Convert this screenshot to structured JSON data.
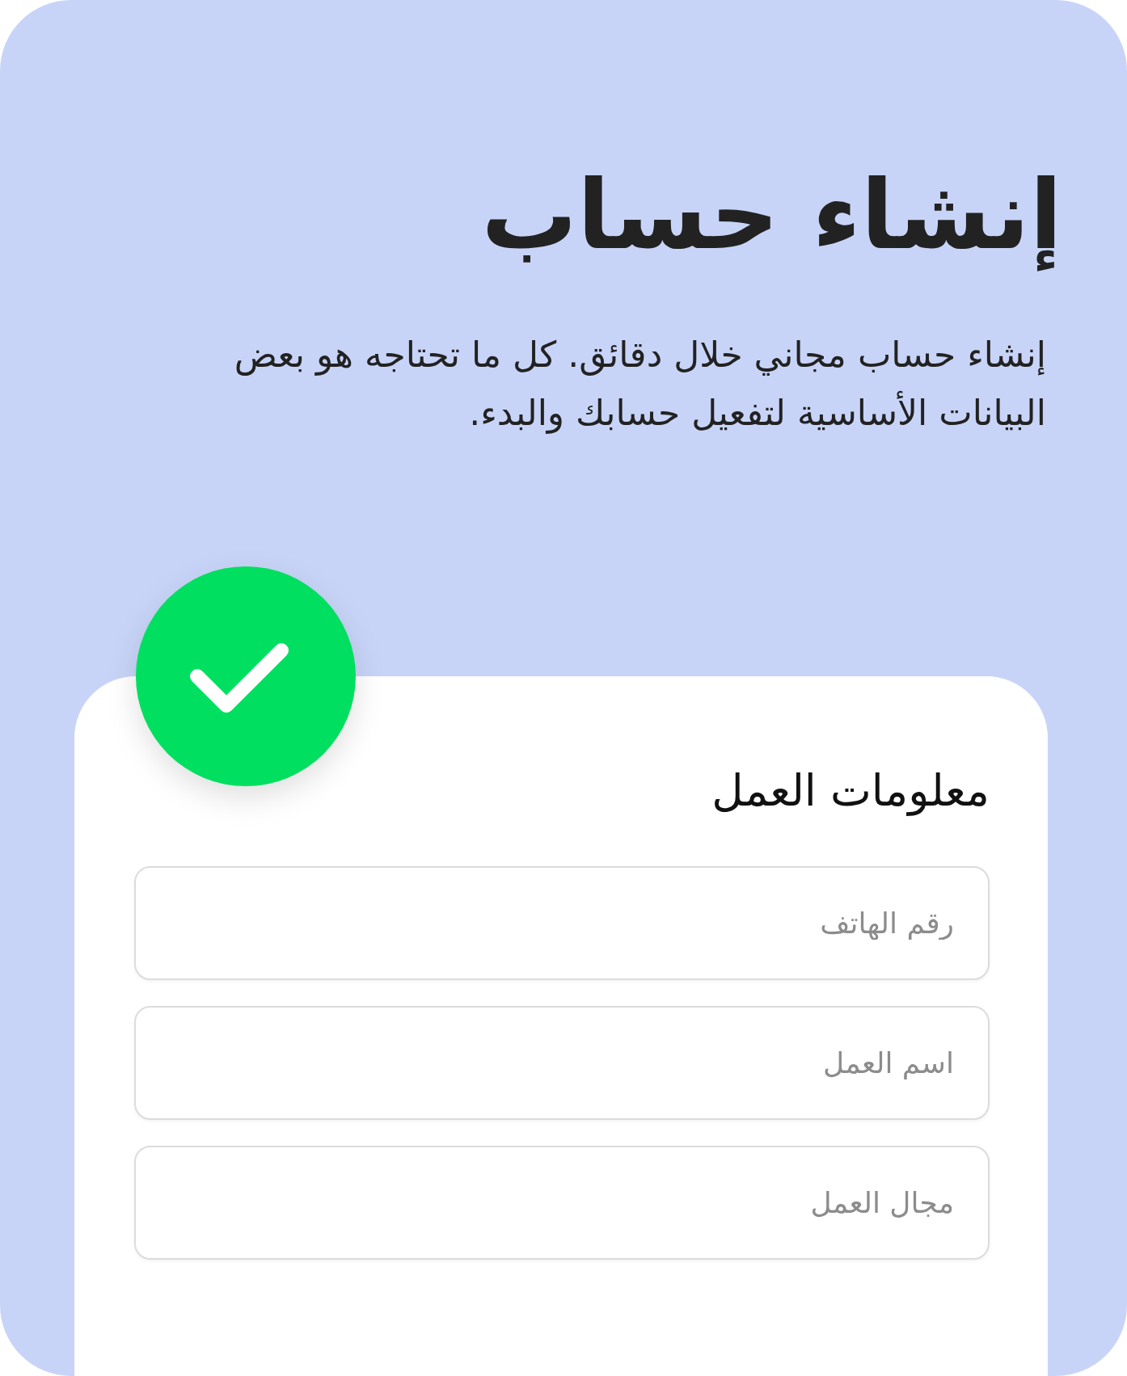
{
  "title": "إنشاء حساب",
  "description": "إنشاء حساب مجاني خلال دقائق. كل ما تحتاجه هو بعض البيانات الأساسية لتفعيل حسابك والبدء.",
  "card": {
    "title": "معلومات العمل",
    "fields": [
      {
        "placeholder": "رقم الهاتف"
      },
      {
        "placeholder": "اسم العمل"
      },
      {
        "placeholder": "مجال العمل"
      }
    ]
  }
}
